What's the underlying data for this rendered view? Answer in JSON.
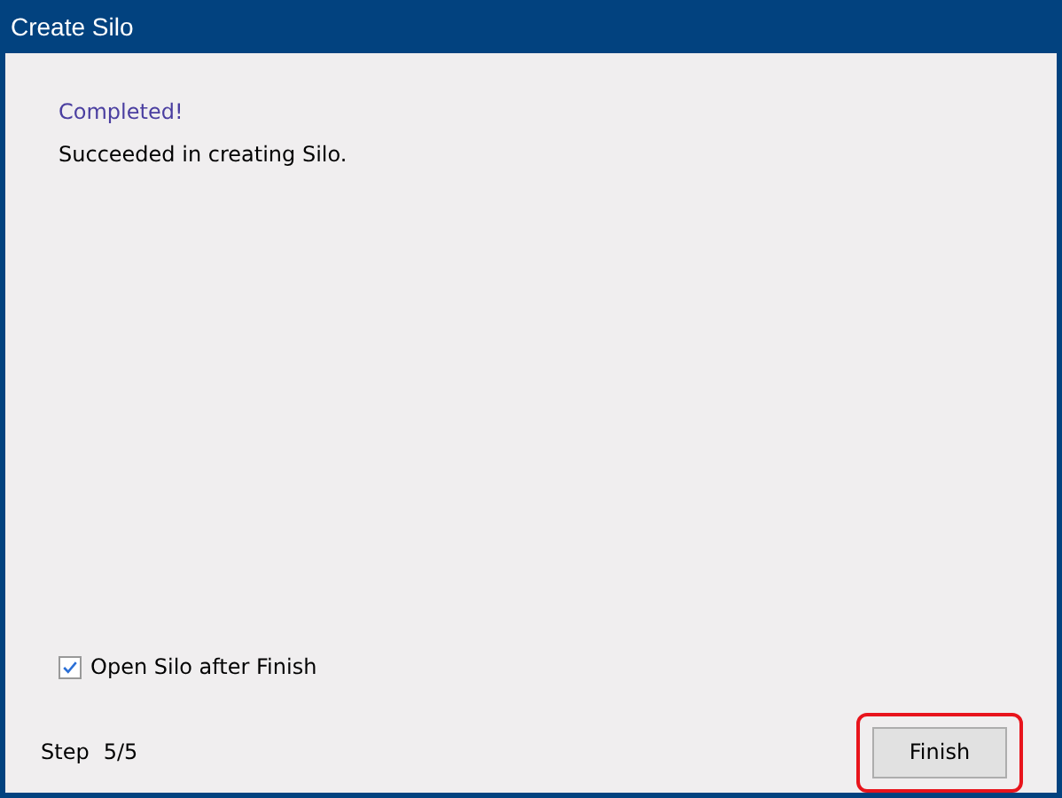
{
  "window": {
    "title": "Create Silo"
  },
  "heading": "Completed!",
  "message": "Succeeded in creating Silo.",
  "option": {
    "label": "Open Silo after Finish",
    "checked": true
  },
  "step": {
    "label": "Step",
    "value": "5/5"
  },
  "finish_button": {
    "label": "Finish",
    "highlighted": true
  }
}
